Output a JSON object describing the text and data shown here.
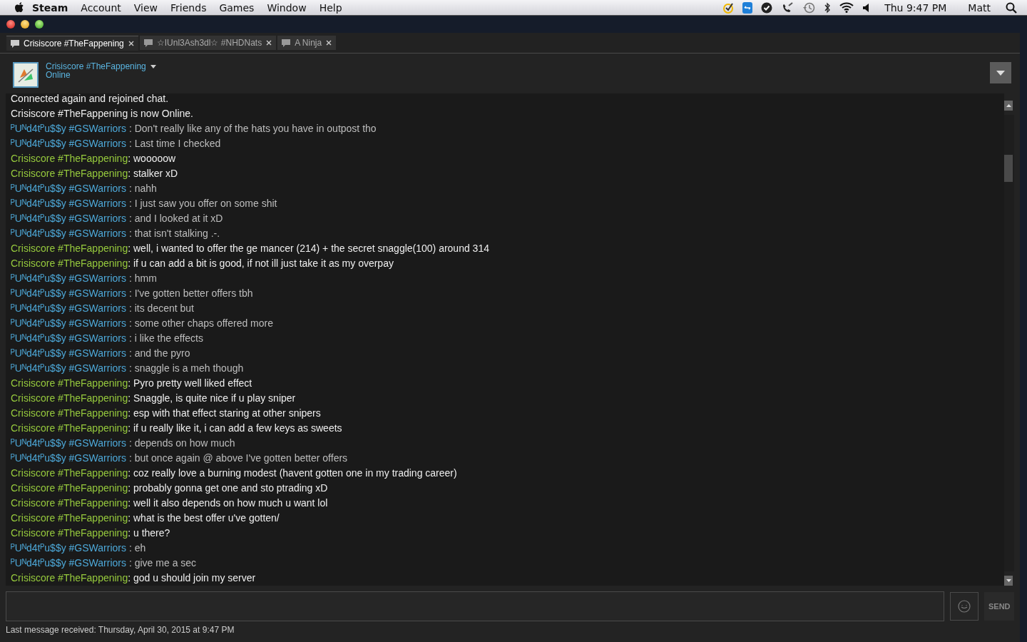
{
  "menu_bar": {
    "app": "Steam",
    "items": [
      "Account",
      "View",
      "Friends",
      "Games",
      "Window",
      "Help"
    ],
    "clock": "Thu 9:47 PM",
    "user": "Matt"
  },
  "tabs": [
    {
      "label": "Crisiscore #TheFappening",
      "selected": true
    },
    {
      "label": "☆IUnl3Ash3dl☆ #NHDNats",
      "selected": false
    },
    {
      "label": "A Ninja",
      "selected": false
    }
  ],
  "header": {
    "name": "Crisiscore #TheFappening",
    "status": "Online"
  },
  "messages": [
    {
      "kind": "system",
      "text": "Connected again and rejoined chat."
    },
    {
      "kind": "system",
      "text": "Crisiscore #TheFappening is now Online."
    },
    {
      "kind": "other",
      "sender": "ᴾUᴺd4tᴾu$$y #GSWarriors",
      "text": ": Don't really like any of the hats you have in outpost tho"
    },
    {
      "kind": "other",
      "sender": "ᴾUᴺd4tᴾu$$y #GSWarriors",
      "text": ": Last time I checked"
    },
    {
      "kind": "self",
      "sender": "Crisiscore #TheFappening",
      "text": ": wooooow"
    },
    {
      "kind": "self",
      "sender": "Crisiscore #TheFappening",
      "text": ": stalker xD"
    },
    {
      "kind": "other",
      "sender": "ᴾUᴺd4tᴾu$$y #GSWarriors",
      "text": ": nahh"
    },
    {
      "kind": "other",
      "sender": "ᴾUᴺd4tᴾu$$y #GSWarriors",
      "text": ": I just saw you offer on some shit"
    },
    {
      "kind": "other",
      "sender": "ᴾUᴺd4tᴾu$$y #GSWarriors",
      "text": ": and I looked at it xD"
    },
    {
      "kind": "other",
      "sender": "ᴾUᴺd4tᴾu$$y #GSWarriors",
      "text": ": that isn't stalking .-."
    },
    {
      "kind": "self",
      "sender": "Crisiscore #TheFappening",
      "text": ": well, i wanted to offer the ge mancer (214) + the secret snaggle(100) around 314"
    },
    {
      "kind": "self",
      "sender": "Crisiscore #TheFappening",
      "text": ": if u can add a bit is good, if not ill just take it as my overpay"
    },
    {
      "kind": "other",
      "sender": "ᴾUᴺd4tᴾu$$y #GSWarriors",
      "text": ": hmm"
    },
    {
      "kind": "other",
      "sender": "ᴾUᴺd4tᴾu$$y #GSWarriors",
      "text": ": I've gotten better offers tbh"
    },
    {
      "kind": "other",
      "sender": "ᴾUᴺd4tᴾu$$y #GSWarriors",
      "text": ": its decent but"
    },
    {
      "kind": "other",
      "sender": "ᴾUᴺd4tᴾu$$y #GSWarriors",
      "text": ": some other chaps offered more"
    },
    {
      "kind": "other",
      "sender": "ᴾUᴺd4tᴾu$$y #GSWarriors",
      "text": ": i like the effects"
    },
    {
      "kind": "other",
      "sender": "ᴾUᴺd4tᴾu$$y #GSWarriors",
      "text": ": and the pyro"
    },
    {
      "kind": "other",
      "sender": "ᴾUᴺd4tᴾu$$y #GSWarriors",
      "text": ": snaggle is a meh though"
    },
    {
      "kind": "self",
      "sender": "Crisiscore #TheFappening",
      "text": ": Pyro pretty well liked effect"
    },
    {
      "kind": "self",
      "sender": "Crisiscore #TheFappening",
      "text": ": Snaggle, is quite nice if u play sniper"
    },
    {
      "kind": "self",
      "sender": "Crisiscore #TheFappening",
      "text": ": esp with that effect staring at other snipers"
    },
    {
      "kind": "self",
      "sender": "Crisiscore #TheFappening",
      "text": ": if u really like it, i can add a few keys as sweets"
    },
    {
      "kind": "other",
      "sender": "ᴾUᴺd4tᴾu$$y #GSWarriors",
      "text": ": depends on how much"
    },
    {
      "kind": "other",
      "sender": "ᴾUᴺd4tᴾu$$y #GSWarriors",
      "text": ": but once again @ above I've gotten better offers"
    },
    {
      "kind": "self",
      "sender": "Crisiscore #TheFappening",
      "text": ": coz really love a burning modest (havent gotten one in my trading career)"
    },
    {
      "kind": "self",
      "sender": "Crisiscore #TheFappening",
      "text": ": probably gonna get one and sto ptrading xD"
    },
    {
      "kind": "self",
      "sender": "Crisiscore #TheFappening",
      "text": ": well it also depends on how much u want lol"
    },
    {
      "kind": "self",
      "sender": "Crisiscore #TheFappening",
      "text": ": what is the best offer u've gotten/"
    },
    {
      "kind": "self",
      "sender": "Crisiscore #TheFappening",
      "text": ": u there?"
    },
    {
      "kind": "other",
      "sender": "ᴾUᴺd4tᴾu$$y #GSWarriors",
      "text": ": eh"
    },
    {
      "kind": "other",
      "sender": "ᴾUᴺd4tᴾu$$y #GSWarriors",
      "text": ": give me a sec"
    },
    {
      "kind": "self",
      "sender": "Crisiscore #TheFappening",
      "text": ": god u should join my server"
    }
  ],
  "composer": {
    "send": "SEND"
  },
  "footer": "Last message received: Thursday, April 30, 2015 at 9:47 PM"
}
